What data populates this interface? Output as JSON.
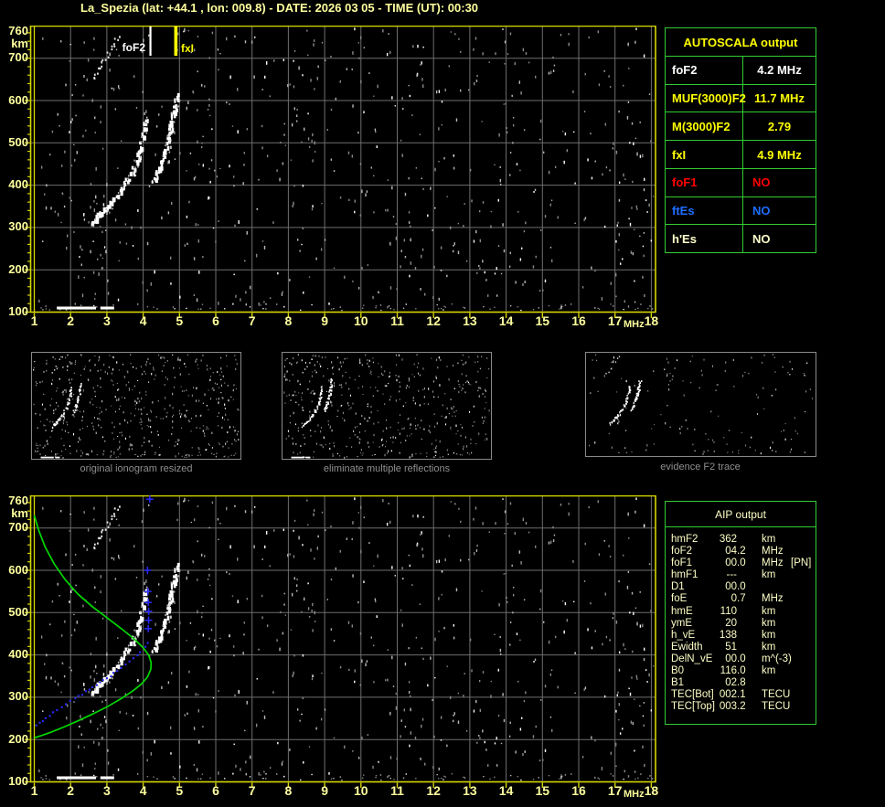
{
  "title": "La_Spezia (lat: +44.1 , lon: 009.8) - DATE: 2026 03 05 - TIME (UT): 00:30",
  "colors": {
    "accent_yellow": "#ffff9e",
    "frame_yellow": "#d6d600",
    "grid_gray": "#6e6e6e",
    "table_green": "#33cc33",
    "pale_text": "#ffffc8",
    "profile_green": "#00d800",
    "profile_blue": "#2a2aff",
    "caption_gray": "#8f8f8f"
  },
  "axis": {
    "x_ticks": [
      "1",
      "2",
      "3",
      "4",
      "5",
      "6",
      "7",
      "8",
      "9",
      "10",
      "11",
      "12",
      "13",
      "14",
      "15",
      "16",
      "17",
      "18"
    ],
    "x_unit": "MHz",
    "y_top_tick": "760",
    "y_unit": "km",
    "y_ticks": [
      "700",
      "600",
      "500",
      "400",
      "300",
      "200",
      "100"
    ],
    "x_range_mhz": [
      1,
      18
    ],
    "y_range_km": [
      100,
      760
    ]
  },
  "plots": {
    "top": {
      "name": "ionogram",
      "markers": [
        {
          "label": "foF2",
          "mhz": 4.2,
          "color": "#ffffff"
        },
        {
          "label": "fxI",
          "mhz": 4.9,
          "color": "#ffff00"
        }
      ]
    },
    "bottom": {
      "name": "profile"
    },
    "trace": {
      "o_trace": [
        [
          2.55,
          308
        ],
        [
          2.75,
          325
        ],
        [
          2.95,
          342
        ],
        [
          3.15,
          360
        ],
        [
          3.35,
          382
        ],
        [
          3.55,
          408
        ],
        [
          3.72,
          432
        ],
        [
          3.85,
          458
        ],
        [
          3.95,
          485
        ],
        [
          4.02,
          512
        ],
        [
          4.07,
          540
        ],
        [
          4.1,
          558
        ]
      ],
      "x_trace": [
        [
          4.3,
          405
        ],
        [
          4.42,
          428
        ],
        [
          4.52,
          452
        ],
        [
          4.62,
          480
        ],
        [
          4.71,
          510
        ],
        [
          4.79,
          540
        ],
        [
          4.86,
          568
        ],
        [
          4.91,
          592
        ],
        [
          4.95,
          608
        ]
      ],
      "echo_trace": [
        [
          2.6,
          655
        ],
        [
          2.75,
          675
        ],
        [
          2.9,
          697
        ],
        [
          3.05,
          718
        ],
        [
          3.2,
          740
        ],
        [
          3.32,
          758
        ]
      ],
      "es_bars_mhz": [
        [
          1.62,
          2.7
        ],
        [
          2.82,
          3.2
        ]
      ],
      "es_km": 110
    },
    "profiles": {
      "green": [
        [
          1.0,
          730
        ],
        [
          1.12,
          695
        ],
        [
          1.3,
          655
        ],
        [
          1.55,
          615
        ],
        [
          1.85,
          578
        ],
        [
          2.2,
          544
        ],
        [
          2.6,
          514
        ],
        [
          3.0,
          488
        ],
        [
          3.4,
          462
        ],
        [
          3.75,
          438
        ],
        [
          4.0,
          417
        ],
        [
          4.15,
          400
        ],
        [
          4.22,
          382
        ],
        [
          4.21,
          366
        ],
        [
          4.12,
          348
        ],
        [
          3.95,
          331
        ],
        [
          3.7,
          314
        ],
        [
          3.38,
          296
        ],
        [
          3.0,
          277
        ],
        [
          2.6,
          260
        ],
        [
          2.2,
          244
        ],
        [
          1.8,
          229
        ],
        [
          1.45,
          217
        ],
        [
          1.18,
          209
        ],
        [
          1.0,
          204
        ]
      ],
      "blue": [
        [
          1.02,
          235
        ],
        [
          1.2,
          247
        ],
        [
          1.4,
          259
        ],
        [
          1.62,
          272
        ],
        [
          1.85,
          285
        ],
        [
          2.1,
          299
        ],
        [
          2.38,
          315
        ],
        [
          2.68,
          331
        ],
        [
          2.98,
          348
        ],
        [
          3.25,
          364
        ],
        [
          3.5,
          380
        ],
        [
          3.72,
          395
        ],
        [
          3.9,
          409
        ],
        [
          4.02,
          421
        ],
        [
          4.1,
          432
        ],
        [
          4.15,
          442
        ]
      ],
      "blue_plus": [
        [
          4.14,
          462
        ],
        [
          4.15,
          482
        ],
        [
          4.15,
          503
        ],
        [
          4.14,
          524
        ],
        [
          4.13,
          550
        ],
        [
          4.12,
          600
        ],
        [
          4.18,
          768
        ]
      ]
    }
  },
  "thumbnails": [
    {
      "caption": "original ionogram resized"
    },
    {
      "caption": "eliminate multiple reflections"
    },
    {
      "caption": "evidence F2 trace"
    }
  ],
  "autoscala": {
    "title": "AUTOSCALA output",
    "rows": [
      {
        "label": "foF2",
        "value": "4.2 MHz",
        "color": "#ffffff",
        "value_align": "center"
      },
      {
        "label": "MUF(3000)F2",
        "value": "11.7 MHz",
        "color": "#ffff00",
        "value_align": "center"
      },
      {
        "label": "M(3000)F2",
        "value": "2.79",
        "color": "#ffff00",
        "value_align": "center"
      },
      {
        "label": "fxI",
        "value": "4.9 MHz",
        "color": "#ffff00",
        "value_align": "center"
      },
      {
        "label": "foF1",
        "value": "NO",
        "color": "#ff0000",
        "value_align": "left"
      },
      {
        "label": "ftEs",
        "value": "NO",
        "color": "#1e6eff",
        "value_align": "left"
      },
      {
        "label": "h'Es",
        "value": "NO",
        "color": "#ffffcc",
        "value_align": "left"
      }
    ]
  },
  "aip": {
    "title": "AIP output",
    "rows": [
      {
        "label": "hmF2",
        "value": "362",
        "unit": "km",
        "extra": ""
      },
      {
        "label": "foF2",
        "value": "04.2",
        "unit": "MHz",
        "extra": ""
      },
      {
        "label": "foF1",
        "value": "00.0",
        "unit": "MHz",
        "extra": "[PN]"
      },
      {
        "label": "hmF1",
        "value": "---",
        "unit": "km",
        "extra": ""
      },
      {
        "label": "D1",
        "value": "00.0",
        "unit": "",
        "extra": ""
      },
      {
        "label": "foE",
        "value": "0.7",
        "unit": "MHz",
        "extra": ""
      },
      {
        "label": "hmE",
        "value": "110",
        "unit": "km",
        "extra": ""
      },
      {
        "label": "ymE",
        "value": "20",
        "unit": "km",
        "extra": ""
      },
      {
        "label": "h_vE",
        "value": "138",
        "unit": "km",
        "extra": ""
      },
      {
        "label": "Ewidth",
        "value": "51",
        "unit": "km",
        "extra": ""
      },
      {
        "label": "DelN_vE",
        "value": "00.0",
        "unit": "m^(-3)",
        "extra": ""
      },
      {
        "label": "B0",
        "value": "116.0",
        "unit": "km",
        "extra": ""
      },
      {
        "label": "B1",
        "value": "02.8",
        "unit": "",
        "extra": ""
      },
      {
        "label": "TEC[Bot]",
        "value": "002.1",
        "unit": "TECU",
        "extra": ""
      },
      {
        "label": "TEC[Top]",
        "value": "003.2",
        "unit": "TECU",
        "extra": ""
      }
    ]
  }
}
